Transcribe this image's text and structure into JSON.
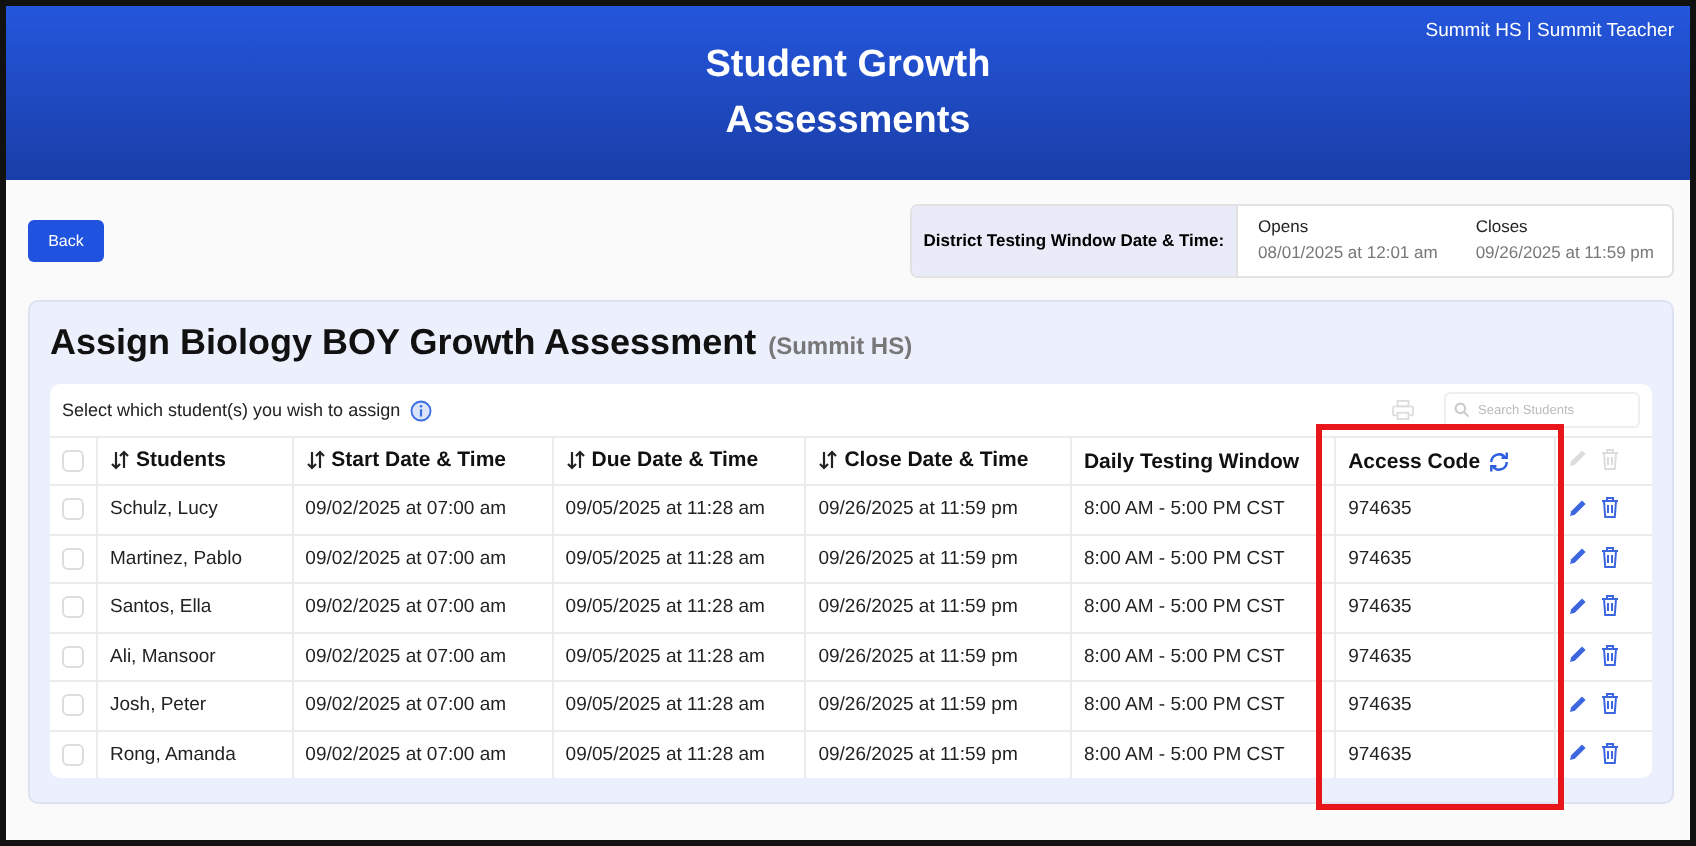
{
  "header": {
    "title_lines": [
      "Student Growth",
      "Assessments"
    ],
    "user": "Summit HS | Summit Teacher"
  },
  "back_button": "Back",
  "district_window": {
    "label": "District Testing Window Date & Time:",
    "opens": {
      "label": "Opens",
      "value": "08/01/2025 at 12:01 am"
    },
    "closes": {
      "label": "Closes",
      "value": "09/26/2025 at 11:59 pm"
    }
  },
  "assign": {
    "title": "Assign Biology BOY Growth Assessment",
    "school": "(Summit HS)",
    "instruction": "Select which student(s) you wish to assign",
    "search": {
      "placeholder": "Search Students"
    }
  },
  "table": {
    "select_all_checked": false,
    "columns": [
      {
        "label": "Students",
        "sortable": true
      },
      {
        "label": "Start Date & Time",
        "sortable": true
      },
      {
        "label": "Due Date & Time",
        "sortable": true
      },
      {
        "label": "Close Date & Time",
        "sortable": true
      },
      {
        "label": "Daily Testing Window",
        "sortable": false
      },
      {
        "label": "Access Code",
        "sortable": false
      }
    ],
    "header_actions_disabled": true,
    "rows": [
      {
        "checked": false,
        "cells": [
          "Schulz, Lucy",
          "09/02/2025 at 07:00 am",
          "09/05/2025 at 11:28 am",
          "09/26/2025 at 11:59 pm",
          "8:00 AM - 5:00 PM CST",
          "974635"
        ]
      },
      {
        "checked": false,
        "cells": [
          "Martinez, Pablo",
          "09/02/2025 at 07:00 am",
          "09/05/2025 at 11:28 am",
          "09/26/2025 at 11:59 pm",
          "8:00 AM - 5:00 PM CST",
          "974635"
        ]
      },
      {
        "checked": false,
        "cells": [
          "Santos, Ella",
          "09/02/2025 at 07:00 am",
          "09/05/2025 at 11:28 am",
          "09/26/2025 at 11:59 pm",
          "8:00 AM - 5:00 PM CST",
          "974635"
        ]
      },
      {
        "checked": false,
        "cells": [
          "Ali, Mansoor",
          "09/02/2025 at 07:00 am",
          "09/05/2025 at 11:28 am",
          "09/26/2025 at 11:59 pm",
          "8:00 AM - 5:00 PM CST",
          "974635"
        ]
      },
      {
        "checked": false,
        "cells": [
          "Josh, Peter",
          "09/02/2025 at 07:00 am",
          "09/05/2025 at 11:28 am",
          "09/26/2025 at 11:59 pm",
          "8:00 AM - 5:00 PM CST",
          "974635"
        ]
      },
      {
        "checked": false,
        "cells": [
          "Rong, Amanda",
          "09/02/2025 at 07:00 am",
          "09/05/2025 at 11:28 am",
          "09/26/2025 at 11:59 pm",
          "8:00 AM - 5:00 PM CST",
          "974635"
        ]
      }
    ]
  },
  "highlight": {
    "color": "#e8161b"
  }
}
